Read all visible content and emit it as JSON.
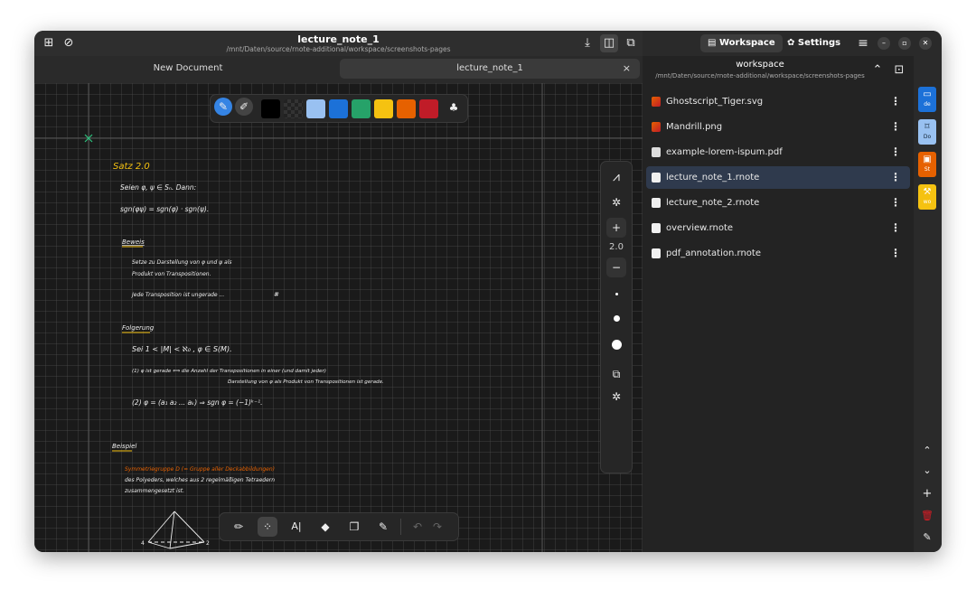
{
  "window": {
    "title": "lecture_note_1",
    "path": "/mnt/Daten/source/rnote-additional/workspace/screenshots-pages"
  },
  "header": {
    "workspace_btn": "Workspace",
    "settings_btn": "Settings",
    "icons": [
      "new-document-icon",
      "eye-off-icon",
      "download-icon",
      "split-view-icon",
      "zoom-page-icon",
      "menu-icon",
      "minimize-icon",
      "maximize-icon",
      "close-icon"
    ]
  },
  "tabs": [
    {
      "label": "New Document"
    },
    {
      "label": "lecture_note_1",
      "active": true,
      "close": "×"
    }
  ],
  "pen_bar": {
    "colors": [
      "#000000",
      "#222222",
      "#99c1f1",
      "#1c71d8",
      "#26a269",
      "#f5c211",
      "#e66100",
      "#c01c28"
    ]
  },
  "side_tools": {
    "stroke_width": "2.0",
    "plus": "+",
    "minus": "−"
  },
  "bottom_tools": [
    "brush-icon",
    "shaper-icon",
    "typewriter-icon",
    "eraser-icon",
    "selector-icon",
    "tools-icon",
    "undo-icon",
    "redo-icon"
  ],
  "workspace": {
    "name": "workspace",
    "path": "/mnt/Daten/source/rnote-additional/workspace/screenshots-pages",
    "files": [
      {
        "name": "Ghostscript_Tiger.svg",
        "type": "image"
      },
      {
        "name": "Mandrill.png",
        "type": "image"
      },
      {
        "name": "example-lorem-ispum.pdf",
        "type": "pdf"
      },
      {
        "name": "lecture_note_1.rnote",
        "type": "rnote",
        "selected": true
      },
      {
        "name": "lecture_note_2.rnote",
        "type": "rnote"
      },
      {
        "name": "overview.rnote",
        "type": "rnote"
      },
      {
        "name": "pdf_annotation.rnote",
        "type": "rnote"
      }
    ]
  },
  "workspaces": [
    {
      "abbr": "de",
      "color": "#1c71d8"
    },
    {
      "abbr": "Do",
      "color": "#99c1f1"
    },
    {
      "abbr": "St",
      "color": "#e66100"
    },
    {
      "abbr": "wo",
      "color": "#f5c211"
    }
  ],
  "note": {
    "heading1": "Satz 2.0",
    "heading2": "Beweis",
    "heading3": "Folgerung",
    "heading4": "Beispiel",
    "line1": "Seien φ, ψ ∈ Sₙ. Dann:",
    "line2": "sgn(φψ) = sgn(φ) · sgn(ψ).",
    "line3": "Setze zu Darstellung von φ und ψ als",
    "line4": "Produkt von Transpositionen.",
    "line5": "Jede Transposition ist ungerade ...",
    "qed": "#",
    "line6": "Sei 1 < |M| < ℵ₀ , φ ∈ S(M).",
    "line7a": "(1) φ ist gerade ⟺ die Anzahl der Transpositionen in einer (und damit jeder)",
    "line7b": "Darstellung von φ als Produkt von Transpositionen ist gerade.",
    "line8": "(2) φ = (a₁ a₂ ... aₖ) ⇒ sgn φ = (−1)ᵏ⁻¹.",
    "line9": "Symmetriegruppe D (= Gruppe aller Deckabbildungen)",
    "line10": "des Polyeders, welches aus 2 regelmäßigen Tetraedern",
    "line11": "zusammengesetzt ist.",
    "label4": "4",
    "label2": "2"
  }
}
